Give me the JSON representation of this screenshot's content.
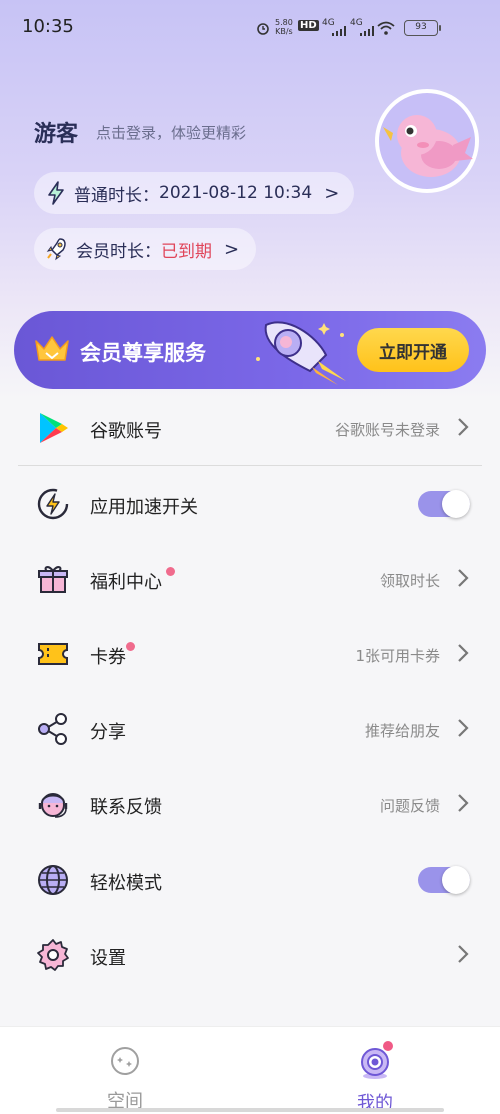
{
  "status_bar": {
    "time": "10:35",
    "net_speed": "5.80",
    "net_unit": "KB/s",
    "hd_label": "HD",
    "signal_1": "4G",
    "signal_2": "4G",
    "battery": "93"
  },
  "profile": {
    "username": "游客",
    "login_hint": "点击登录，体验更精彩",
    "normal_duration_label": "普通时长：",
    "normal_duration_value": "2021-08-12 10:34",
    "vip_duration_label": "会员时长：",
    "vip_duration_value": "已到期",
    "chevron": ">"
  },
  "vip_banner": {
    "title": "会员尊享服务",
    "button_label": "立即开通"
  },
  "menu": [
    {
      "label": "谷歌账号",
      "value": "谷歌账号未登录",
      "icon": "google-play-icon"
    },
    {
      "label": "应用加速开关",
      "value": "",
      "icon": "speed-bolt-icon",
      "toggle": true
    },
    {
      "label": "福利中心",
      "value": "领取时长",
      "icon": "gift-icon",
      "dot": true
    },
    {
      "label": "卡券",
      "value": "1张可用卡券",
      "icon": "ticket-icon",
      "dot": true
    },
    {
      "label": "分享",
      "value": "推荐给朋友",
      "icon": "share-icon"
    },
    {
      "label": "联系反馈",
      "value": "问题反馈",
      "icon": "support-agent-icon"
    },
    {
      "label": "轻松模式",
      "value": "",
      "icon": "globe-icon",
      "toggle": true
    },
    {
      "label": "设置",
      "value": "",
      "icon": "gear-icon"
    }
  ],
  "bottom_nav": {
    "space_label": "空间",
    "mine_label": "我的"
  },
  "colors": {
    "accent": "#6f58d6",
    "banner": "#7b68e8",
    "vip_button": "#ffc21a",
    "expired": "#e0455a",
    "toggle_on": "#9a93ea",
    "badge": "#f06b8d"
  }
}
